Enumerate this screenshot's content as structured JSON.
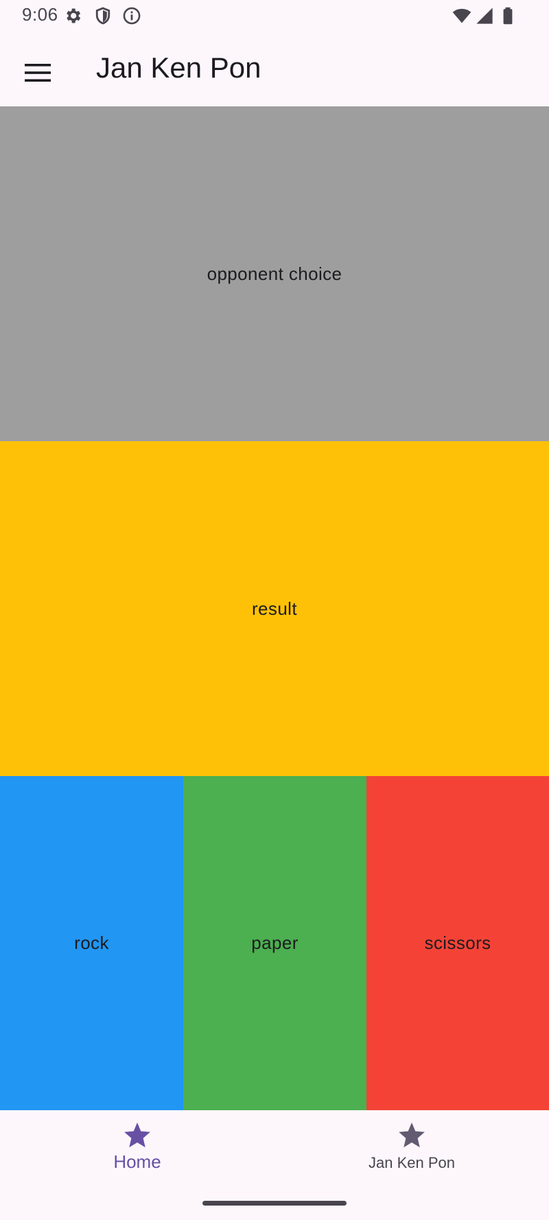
{
  "status_bar": {
    "time": "9:06",
    "left_icons": [
      "gear-icon",
      "shield-icon",
      "info-icon"
    ],
    "right_icons": [
      "wifi-icon",
      "signal-icon",
      "battery-icon"
    ]
  },
  "app_bar": {
    "title": "Jan Ken Pon",
    "menu_icon": "hamburger-menu-icon"
  },
  "panels": {
    "opponent": {
      "label": "opponent choice",
      "color": "#9e9e9e"
    },
    "result": {
      "label": "result",
      "color": "#ffc107"
    },
    "choices": [
      {
        "label": "rock",
        "color": "#2196f3"
      },
      {
        "label": "paper",
        "color": "#4caf50"
      },
      {
        "label": "scissors",
        "color": "#f44336"
      }
    ]
  },
  "bottom_nav": {
    "items": [
      {
        "label": "Home",
        "icon": "star-icon",
        "active": true
      },
      {
        "label": "Jan Ken Pon",
        "icon": "star-icon",
        "active": false
      }
    ],
    "active_color": "#6750a4",
    "inactive_color": "#49454f"
  }
}
